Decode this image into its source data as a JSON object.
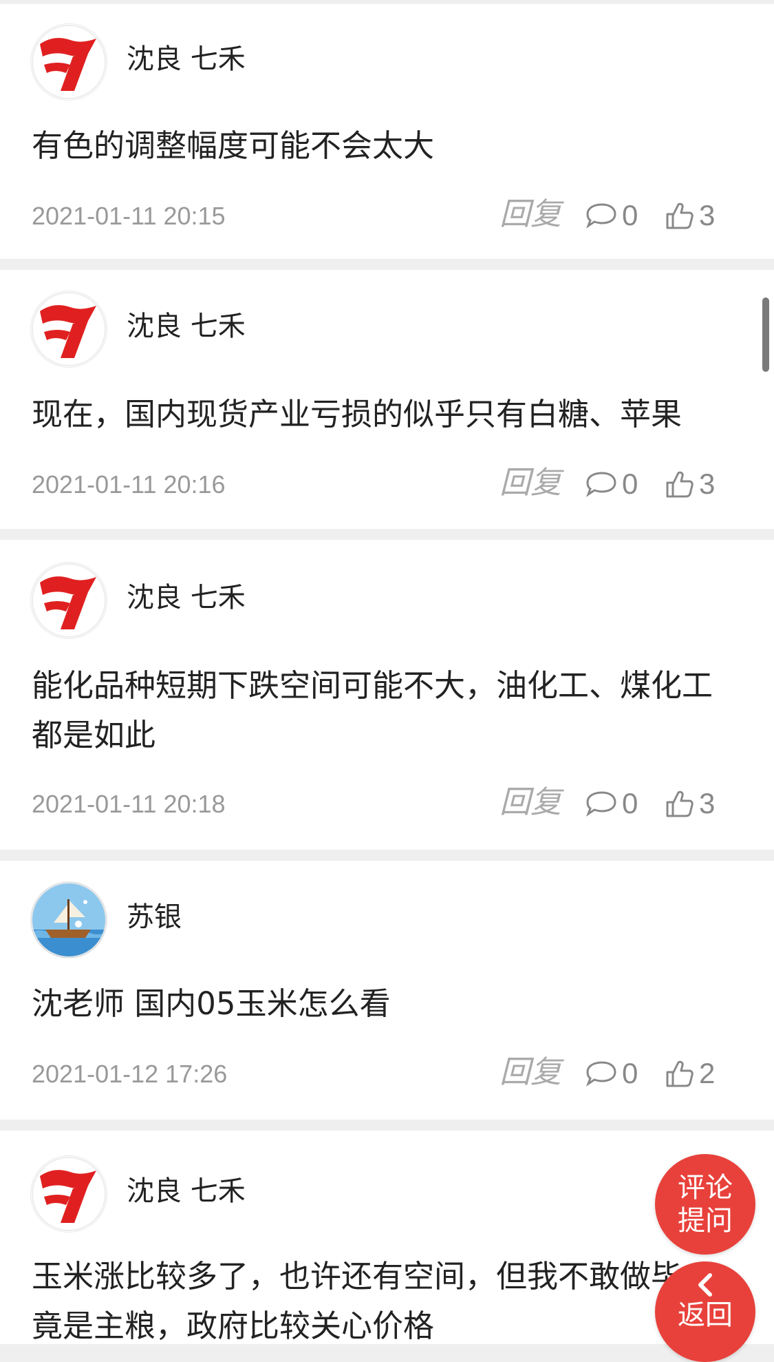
{
  "comments": [
    {
      "user": "沈良 七禾",
      "avatar": "qihe-logo",
      "text": "有色的调整幅度可能不会太大",
      "time": "2021-01-11 20:15",
      "reply_label": "回复",
      "comment_count": "0",
      "like_count": "3"
    },
    {
      "user": "沈良 七禾",
      "avatar": "qihe-logo",
      "text": "现在，国内现货产业亏损的似乎只有白糖、苹果",
      "time": "2021-01-11 20:16",
      "reply_label": "回复",
      "comment_count": "0",
      "like_count": "3"
    },
    {
      "user": "沈良 七禾",
      "avatar": "qihe-logo",
      "text": "能化品种短期下跌空间可能不大，油化工、煤化工都是如此",
      "time": "2021-01-11 20:18",
      "reply_label": "回复",
      "comment_count": "0",
      "like_count": "3"
    },
    {
      "user": "苏银",
      "avatar": "sailing-ship-avatar",
      "text": "沈老师 国内05玉米怎么看",
      "time": "2021-01-12 17:26",
      "reply_label": "回复",
      "comment_count": "0",
      "like_count": "2"
    },
    {
      "user": "沈良 七禾",
      "avatar": "qihe-logo",
      "text": "玉米涨比较多了，也许还有空间，但我不敢做毕竟是主粮，政府比较关心价格"
    }
  ],
  "fab_comment": {
    "line1": "评论",
    "line2": "提问"
  },
  "fab_back": {
    "label": "返回",
    "icon": "chevron-left-icon"
  },
  "colors": {
    "accent": "#e8413b",
    "timestamp": "#999999",
    "divider": "#efefef"
  }
}
